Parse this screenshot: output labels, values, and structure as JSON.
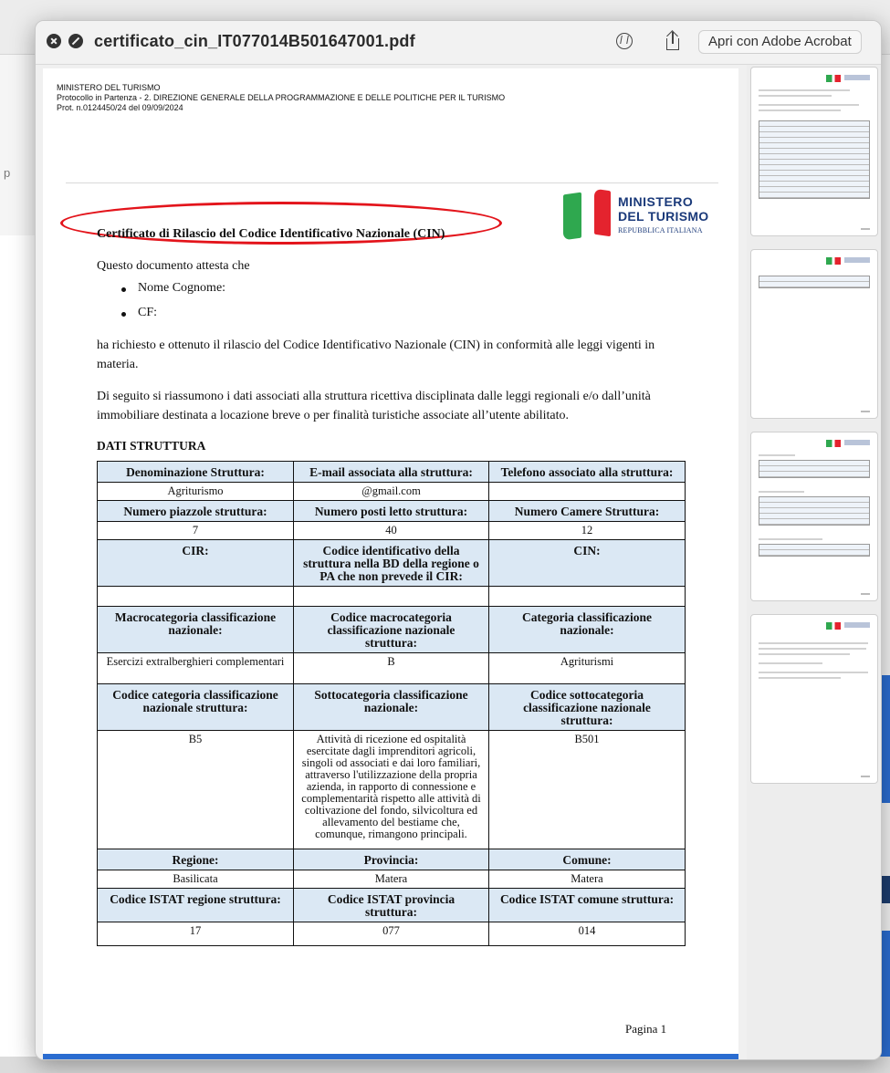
{
  "window": {
    "title": "certificato_cin_IT077014B501647001.pdf",
    "open_button": "Apri con Adobe Acrobat",
    "icons": [
      "close-icon",
      "fullscreen-icon",
      "markup-icon",
      "share-icon"
    ]
  },
  "background": {
    "left_letter": "p"
  },
  "document": {
    "header": {
      "line1": "MINISTERO DEL TURISMO",
      "line2": "Protocollo in Partenza  -  2. DIREZIONE GENERALE DELLA PROGRAMMAZIONE E DELLE POLITICHE PER IL TURISMO",
      "line3": "Prot. n.0124450/24 del 09/09/2024"
    },
    "logo": {
      "line1": "MINISTERO",
      "line2": "DEL TURISMO",
      "line3": "REPUBBLICA ITALIANA"
    },
    "title": "Certificato di Rilascio del Codice Identificativo Nazionale (CIN)",
    "intro": "Questo documento attesta che",
    "bullets": [
      "Nome Cognome:",
      "CF:"
    ],
    "para1": "ha richiesto e ottenuto il rilascio del Codice Identificativo Nazionale (CIN) in conformità alle leggi vigenti in materia.",
    "para2": "Di seguito si riassumono i dati associati alla struttura ricettiva disciplinata dalle leggi regionali e/o dall’unità immobiliare destinata a locazione breve o per finalità turistiche associate all’utente abilitato.",
    "section_title": "DATI STRUTTURA",
    "table": [
      {
        "type": "h",
        "cells": [
          "Denominazione Struttura:",
          "E-mail associata alla struttura:",
          "Telefono associato alla struttura:"
        ]
      },
      {
        "type": "v",
        "cells": [
          "Agriturismo",
          "@gmail.com",
          ""
        ]
      },
      {
        "type": "h",
        "cells": [
          "Numero piazzole struttura:",
          "Numero posti letto struttura:",
          "Numero Camere Struttura:"
        ]
      },
      {
        "type": "v",
        "cells": [
          "7",
          "40",
          "12"
        ]
      },
      {
        "type": "h",
        "cells": [
          "CIR:",
          "Codice identificativo della struttura nella BD della regione o PA che non prevede il CIR:",
          "CIN:"
        ]
      },
      {
        "type": "v",
        "cells": [
          "",
          "",
          ""
        ]
      },
      {
        "type": "h",
        "cells": [
          "Macrocategoria classificazione nazionale:",
          "Codice macrocategoria classificazione nazionale struttura:",
          "Categoria classificazione nazionale:"
        ]
      },
      {
        "type": "v",
        "cells": [
          "Esercizi extralberghieri complementari",
          "B",
          "Agriturismi"
        ]
      },
      {
        "type": "h",
        "cells": [
          "Codice categoria classificazione nazionale struttura:",
          "Sottocategoria classificazione nazionale:",
          "Codice sottocategoria classificazione nazionale struttura:"
        ]
      },
      {
        "type": "v",
        "cells": [
          "B5",
          "Attività di ricezione ed ospitalità esercitate dagli imprenditori agricoli, singoli od associati e dai loro familiari, attraverso l'utilizzazione della propria azienda, in rapporto di connessione e complementarità rispetto alle attività di coltivazione del fondo, silvicoltura ed allevamento del bestiame che, comunque, rimangono principali.",
          "B501"
        ]
      },
      {
        "type": "h",
        "cells": [
          "Regione:",
          "Provincia:",
          "Comune:"
        ]
      },
      {
        "type": "v",
        "cells": [
          "Basilicata",
          "Matera",
          "Matera"
        ]
      },
      {
        "type": "h",
        "cells": [
          "Codice ISTAT regione struttura:",
          "Codice ISTAT provincia struttura:",
          "Codice ISTAT comune struttura:"
        ]
      },
      {
        "type": "v",
        "cells": [
          "17",
          "077",
          "014"
        ]
      }
    ],
    "page_number": "Pagina 1"
  },
  "thumbnails": [
    "page-1",
    "page-2",
    "page-3",
    "page-4"
  ],
  "colors": {
    "header_fill": "#dbe8f4",
    "annotation": "#e3141b",
    "ministry_blue": "#1b3a7a",
    "flag_green": "#2fa84f",
    "flag_red": "#e4232e",
    "bottom_bar": "#2a6cd0"
  }
}
